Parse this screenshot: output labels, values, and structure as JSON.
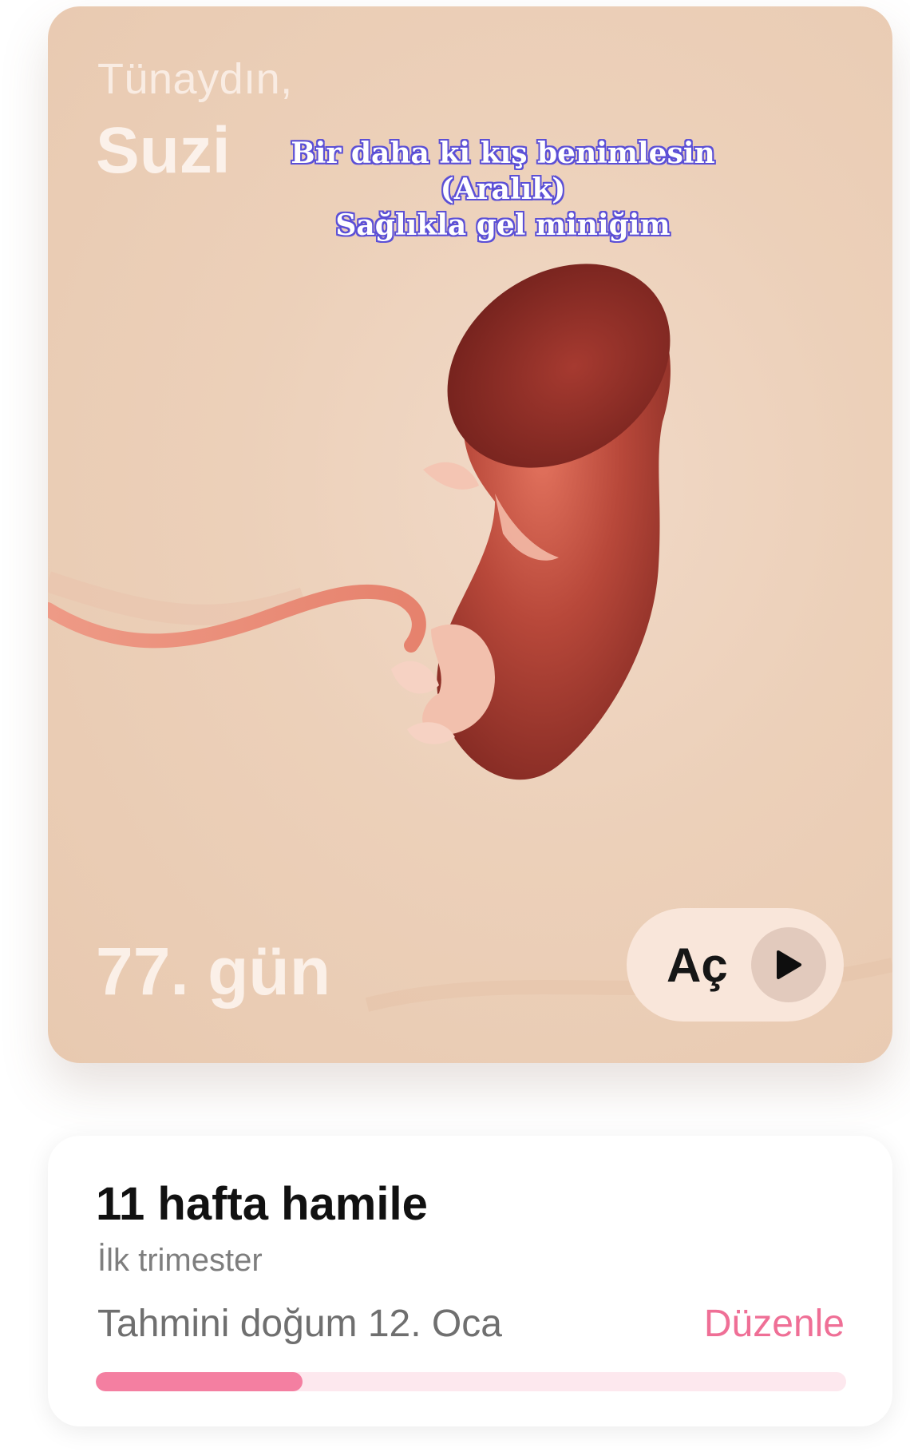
{
  "hero": {
    "greeting": "Tünaydın,",
    "name": "Suzi",
    "caption_lines": [
      "Bir daha ki kış benimlesin",
      "(Aralık)",
      "Sağlıkla gel miniğim"
    ],
    "day_label": "77. gün",
    "open_button_label": "Aç",
    "open_button_icon": "play-icon"
  },
  "pregnancy": {
    "weeks_title": "11 hafta hamile",
    "trimester": "İlk trimester",
    "due_date": "Tahmini doğum 12. Oca",
    "edit_label": "Düzenle",
    "progress": 0.275
  },
  "colors": {
    "accent": "#f47fa1",
    "hero_bg": "#ecd0b9"
  }
}
